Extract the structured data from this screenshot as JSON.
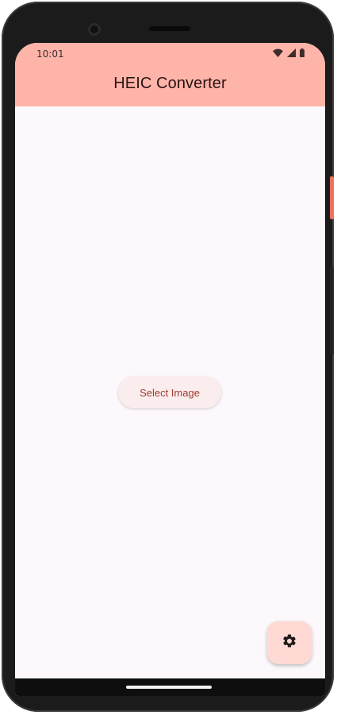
{
  "status_bar": {
    "time": "10:01",
    "icons": [
      "wifi-icon",
      "cellular-signal-icon",
      "battery-icon"
    ]
  },
  "app_bar": {
    "title": "HEIC Converter",
    "background_color": "#ffb4a9"
  },
  "main": {
    "select_button_label": "Select Image",
    "select_button_text_color": "#9c3b2f"
  },
  "fab": {
    "icon": "gear-icon",
    "background_color": "#ffdad4"
  }
}
